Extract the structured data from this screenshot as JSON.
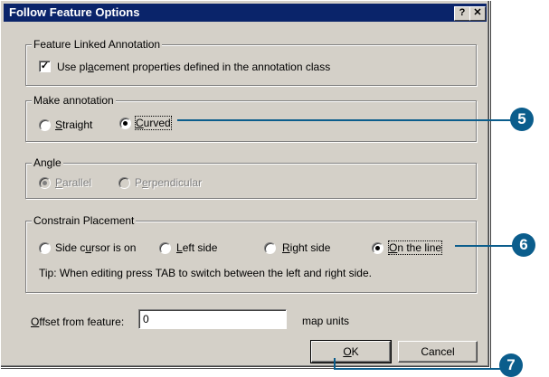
{
  "window": {
    "title": "Follow Feature Options",
    "help_glyph": "?",
    "close_glyph": "✕"
  },
  "feature_linked": {
    "legend": "Feature Linked Annotation",
    "checkbox_label_pre": "Use pl",
    "checkbox_label_ul": "a",
    "checkbox_label_post": "cement properties defined in the annotation class",
    "checked": true
  },
  "make_annotation": {
    "legend": "Make annotation",
    "options": [
      {
        "pre": "",
        "ul": "S",
        "post": "traight",
        "selected": false
      },
      {
        "pre": "",
        "ul": "C",
        "post": "urved",
        "selected": true
      }
    ]
  },
  "angle": {
    "legend": "Angle",
    "options": [
      {
        "pre": "",
        "ul": "P",
        "post": "arallel",
        "selected": true
      },
      {
        "pre": "P",
        "ul": "e",
        "post": "rpendicular",
        "selected": false
      }
    ]
  },
  "constrain": {
    "legend": "Constrain Placement",
    "options": [
      {
        "pre": "Side c",
        "ul": "u",
        "post": "rsor is on",
        "selected": false
      },
      {
        "pre": "",
        "ul": "L",
        "post": "eft side",
        "selected": false
      },
      {
        "pre": "",
        "ul": "R",
        "post": "ight side",
        "selected": false
      },
      {
        "pre": "",
        "ul": "O",
        "post": "n the line",
        "selected": true
      }
    ],
    "tip": "Tip:  When editing press TAB to switch between the left and right side."
  },
  "offset": {
    "label_ul": "O",
    "label_post": "ffset from feature:",
    "value": "0",
    "units": "map units"
  },
  "buttons": {
    "ok_ul": "O",
    "ok_post": "K",
    "cancel": "Cancel"
  },
  "callouts": {
    "c5": "5",
    "c6": "6",
    "c7": "7"
  },
  "colors": {
    "titlebar": "#0a246a",
    "dialog": "#d4d0c8",
    "callout": "#0b5d8c"
  }
}
